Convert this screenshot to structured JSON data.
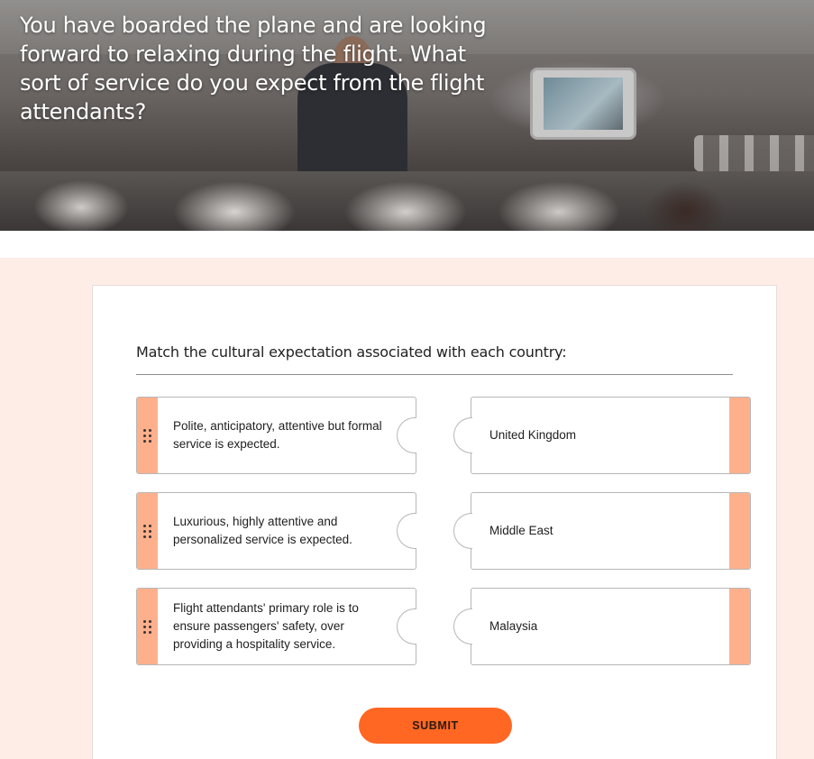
{
  "hero": {
    "text": "You have boarded the plane and are looking forward to relaxing during the flight. What sort of service do you expect from the flight attendants?"
  },
  "activity": {
    "question": "Match the cultural expectation associated with each country:",
    "prompts": [
      "Polite, anticipatory, attentive but formal service is expected.",
      "Luxurious, highly attentive and personalized service is expected.",
      "Flight attendants' primary role is to ensure passengers' safety, over providing a hospitality service."
    ],
    "responses": [
      "United Kingdom",
      "Middle East",
      "Malaysia"
    ],
    "submit_label": "SUBMIT"
  },
  "colors": {
    "accent": "#ff6723",
    "handle": "#feb08d",
    "page_background": "#fdede6"
  },
  "icons": [
    "drag-handle-icon"
  ]
}
